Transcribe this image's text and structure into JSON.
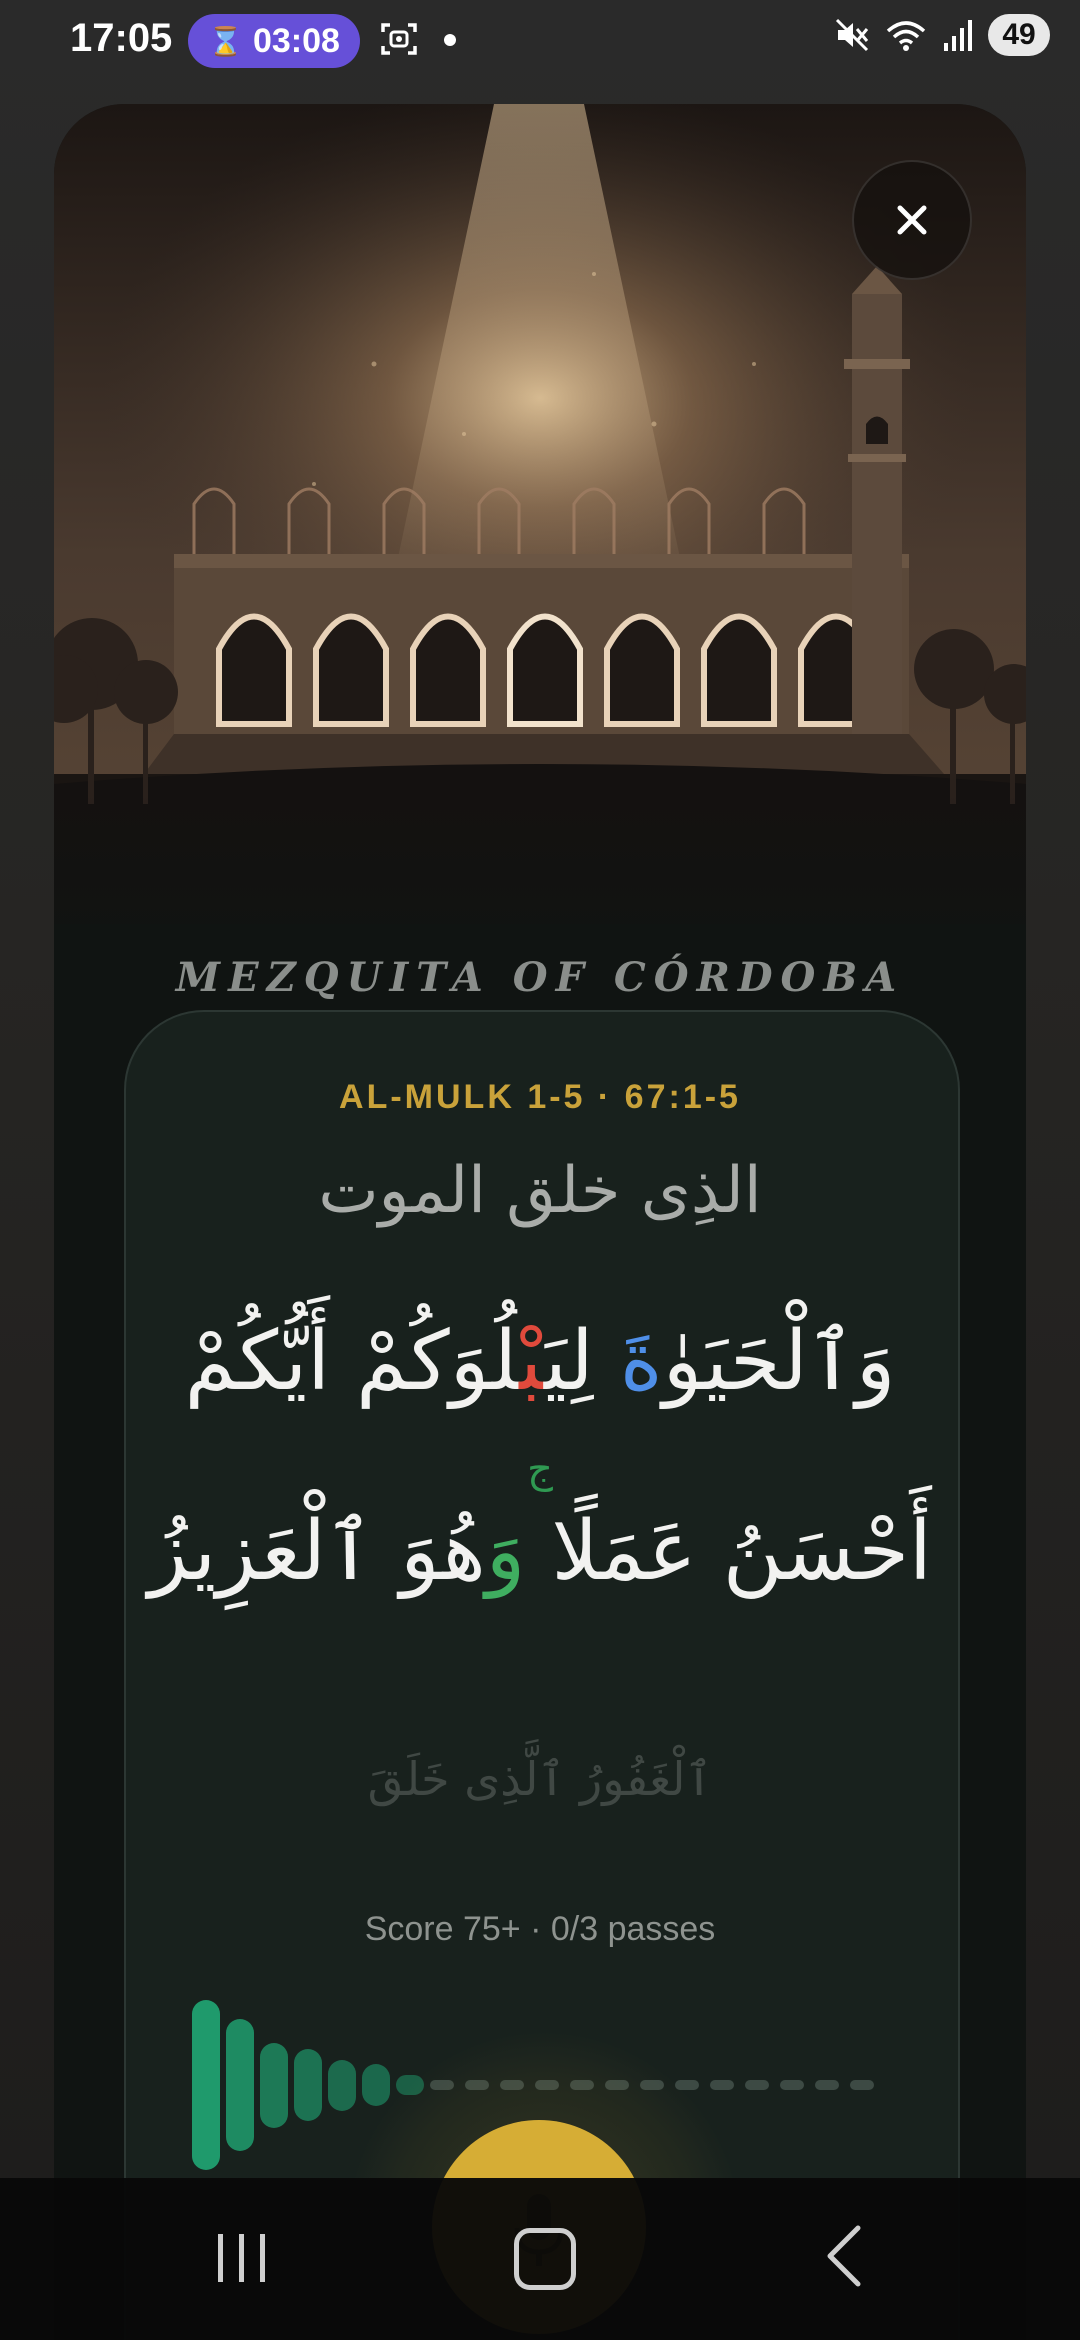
{
  "status_bar": {
    "time": "17:05",
    "timer": "03:08",
    "battery": "49",
    "icons": [
      "hourglass-icon",
      "screenshot-icon",
      "notification-dot",
      "mute-icon",
      "wifi-icon",
      "signal-icon",
      "battery-icon"
    ]
  },
  "scene": {
    "location": "MEZQUITA OF CÓRDOBA",
    "close_icon": "close-icon"
  },
  "recitation": {
    "reference": "AL-MULK 1-5 · 67:1-5",
    "previous_line": "الذِى خلق الموت",
    "line1": {
      "before": "وَٱلْحَيَوٰ",
      "blue": "ةَ",
      "middle": " لِيَ",
      "red": "بْ",
      "after": "لُوَكُمْ أَيُّكُمْ"
    },
    "stop_mark": "ج",
    "line2": {
      "before": "أَحْسَنُ عَمَلًا ",
      "green": "وَ",
      "after": "هُوَ ٱلْعَزِيزُ"
    },
    "next_line": "ٱلْغَفُورُ ٱلَّذِى خَلَقَ",
    "score_text": "Score 75+ · 0/3 passes"
  },
  "waveform": {
    "levels": [
      1.0,
      0.78,
      0.5,
      0.42,
      0.3,
      0.25,
      0.12,
      0.05,
      0.05,
      0.05,
      0.05,
      0.05,
      0.05,
      0.05,
      0.05,
      0.05,
      0.05,
      0.05,
      0.05,
      0.05
    ],
    "active_color": "#1f9a6c",
    "idle_color": "#3d4a44"
  },
  "controls": {
    "mic_icon": "microphone-icon",
    "mic_color": "#d6ad35"
  },
  "nav_bar": {
    "icons": [
      "recents-icon",
      "home-icon",
      "back-icon"
    ]
  },
  "colors": {
    "accent": "#c9a23a",
    "timer_chip": "#6650d8",
    "highlight_blue": "#4f8fe8",
    "highlight_red": "#e04a3c",
    "highlight_green": "#3fae60"
  }
}
